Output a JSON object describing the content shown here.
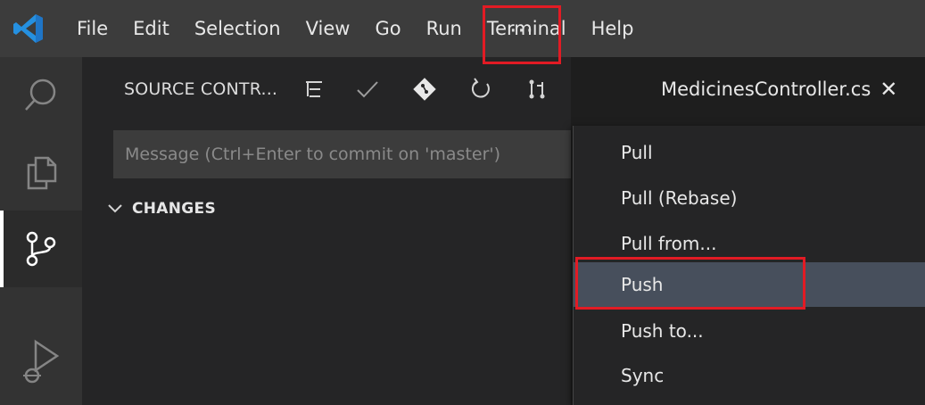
{
  "menubar": {
    "items": [
      "File",
      "Edit",
      "Selection",
      "View",
      "Go",
      "Run",
      "Terminal",
      "Help"
    ]
  },
  "activity_bar": {
    "items": [
      {
        "icon": "search-icon",
        "active": false
      },
      {
        "icon": "explorer-icon",
        "active": false
      },
      {
        "icon": "source-control-icon",
        "active": true
      },
      {
        "icon": "run-debug-icon",
        "active": false
      }
    ]
  },
  "sidebar": {
    "title": "SOURCE CONTR...",
    "toolbar_icons": [
      "tree-view-icon",
      "commit-check-icon",
      "git-icon",
      "refresh-icon",
      "pull-request-icon",
      "more-actions-icon"
    ],
    "more_label": "···",
    "commit_message": {
      "placeholder": "Message (Ctrl+Enter to commit on 'master')",
      "value": ""
    },
    "changes_label": "CHANGES"
  },
  "editor": {
    "tab_label": "MedicinesController.cs",
    "tab_close": "✕"
  },
  "dropdown": {
    "items": [
      {
        "label": "Pull",
        "selected": false
      },
      {
        "label": "Pull (Rebase)",
        "selected": false
      },
      {
        "label": "Pull from...",
        "selected": false
      },
      {
        "label": "Push",
        "selected": true
      },
      {
        "label": "Push to...",
        "selected": false
      },
      {
        "label": "Sync",
        "selected": false
      }
    ]
  },
  "colors": {
    "accent_highlight": "#e21b24",
    "vscode_blue": "#0e7acc",
    "menu_selected": "#474f5c"
  }
}
